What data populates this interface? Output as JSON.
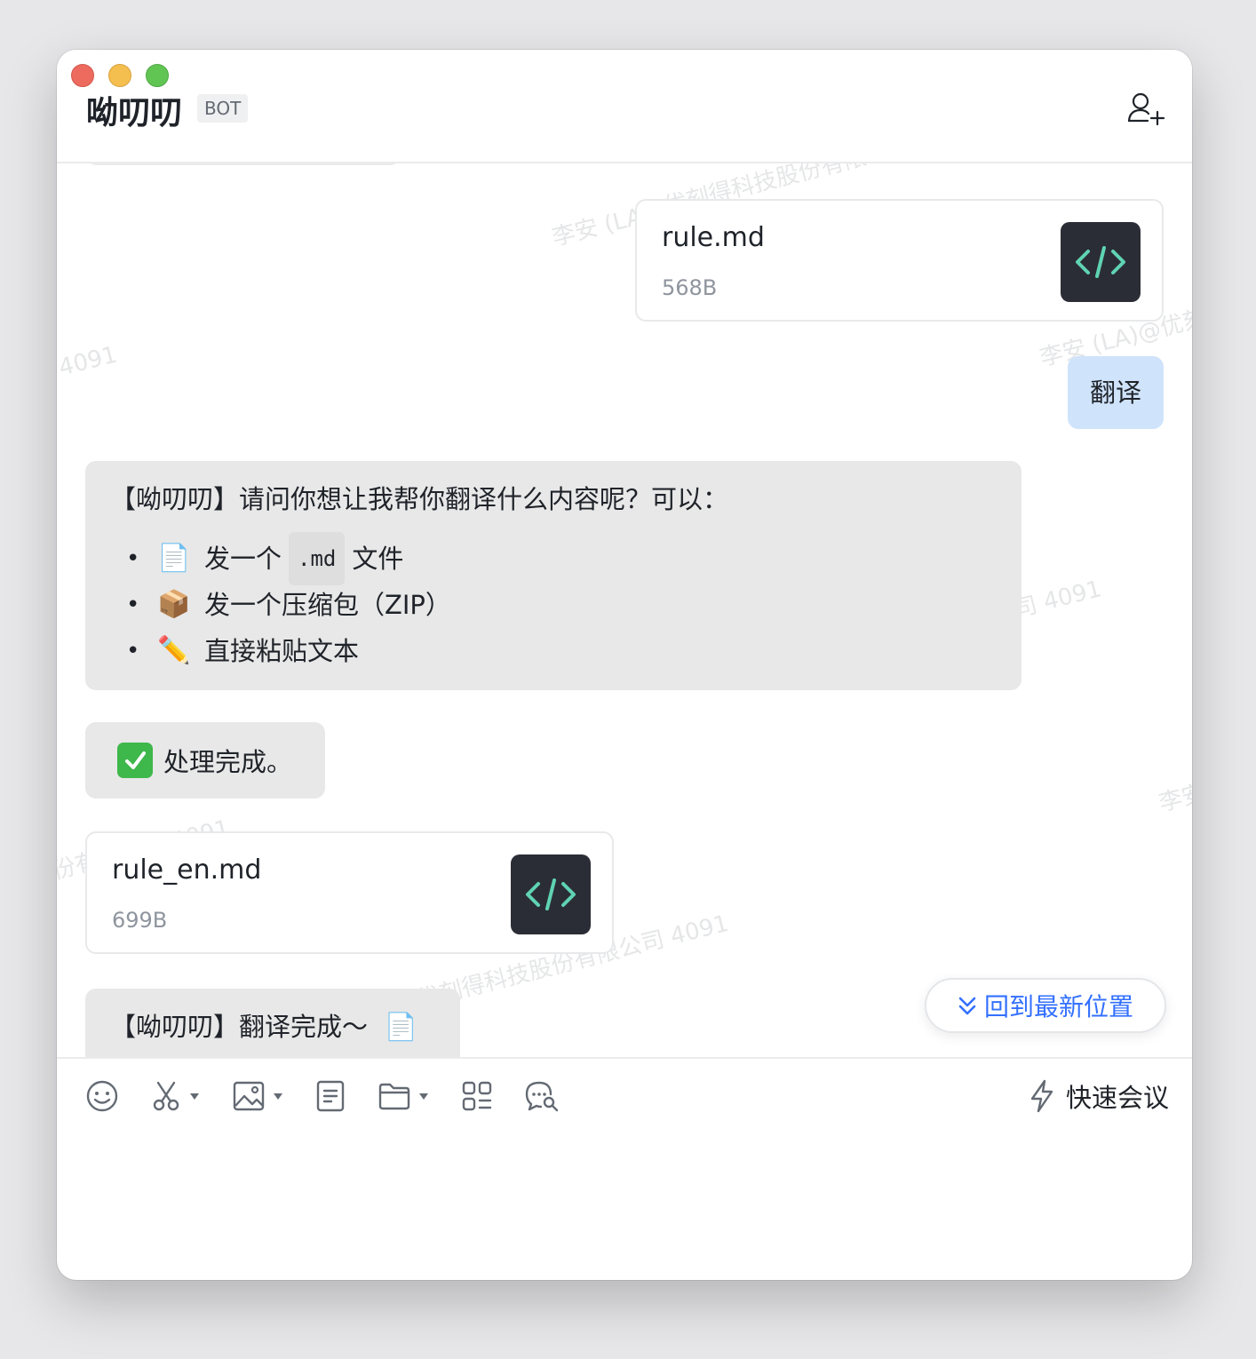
{
  "window": {
    "title": "呦叨叨",
    "badge": "BOT"
  },
  "messages": {
    "file_sent": {
      "name": "rule.md",
      "size": "568B"
    },
    "user_text": "翻译",
    "bot_prompt": {
      "intro": "【呦叨叨】请问你想让我帮你翻译什么内容呢？可以：",
      "items": [
        {
          "emoji": "📄",
          "before": "发一个",
          "code": ".md",
          "after": "文件"
        },
        {
          "emoji": "📦",
          "text": "发一个压缩包（ZIP）"
        },
        {
          "emoji": "✏️",
          "text": "直接粘贴文本"
        }
      ]
    },
    "bot_done": "处理完成。",
    "file_received": {
      "name": "rule_en.md",
      "size": "699B"
    },
    "bot_final": "【呦叨叨】翻译完成～",
    "bot_final_emoji": "📄"
  },
  "watermarks": [
    "李安 (LA)",
    "优刻得科技股份有限",
    "4091",
    "李安 (LA)@优刻",
    "司 4091",
    "李安",
    "份有限公司 4091",
    "优刻得科技股份有限公司 4091"
  ],
  "jump_button": {
    "label": "回到最新位置"
  },
  "toolbar": {
    "quick_meeting": "快速会议"
  },
  "colors": {
    "accent": "#3370ff",
    "user_bubble": "#cfe3fb",
    "bot_bubble": "#e8e8e8",
    "file_icon_bg": "#2b2d36",
    "file_icon_fg": "#5fd3b3"
  },
  "icons": [
    "add-user-icon",
    "code-file-icon",
    "emoji-icon",
    "screenshot-scissors-icon",
    "image-icon",
    "document-icon",
    "folder-icon",
    "apps-grid-icon",
    "chat-search-icon",
    "lightning-icon",
    "chevron-double-down-icon"
  ]
}
